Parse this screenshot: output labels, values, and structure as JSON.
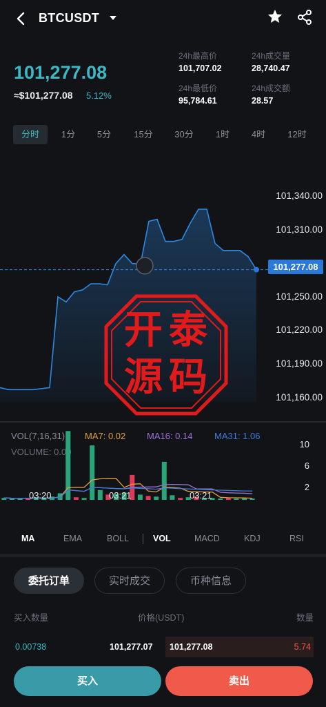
{
  "header": {
    "pair": "BTCUSDT",
    "back_icon": "chevron-left-icon",
    "star_icon": "star-icon",
    "share_icon": "share-icon"
  },
  "ticker": {
    "last_price": "101,277.08",
    "usd_price": "≈$101,277.08",
    "change_pct": "5.12%",
    "high_label": "24h最高价",
    "high_value": "101,707.02",
    "vol_label": "24h成交量",
    "vol_value": "28,740.47",
    "low_label": "24h最低价",
    "low_value": "95,784.61",
    "turnover_label": "24h成交额",
    "turnover_value": "28.57"
  },
  "timeframes": [
    "分时",
    "1分",
    "5分",
    "15分",
    "30分",
    "1时",
    "4时",
    "12时"
  ],
  "chart_data": {
    "type": "area",
    "y_ticks": [
      "101,340.00",
      "101,310.00",
      "101,250.00",
      "101,220.00",
      "101,190.00",
      "101,160.00"
    ],
    "current_price_badge": "101,277.08",
    "x_ticks": [
      "03:20",
      "03:21",
      "03:21"
    ],
    "ylim": [
      101150,
      101350
    ],
    "series": [
      {
        "values": [
          101160,
          101158,
          101158,
          101158,
          101158,
          101159,
          101160,
          101250,
          101245,
          101255,
          101257,
          101263,
          101263,
          101262,
          101283,
          101292,
          101283,
          101283,
          101325,
          101327,
          101305,
          101305,
          101307,
          101323,
          101337,
          101337,
          101303,
          101296,
          101296,
          101296,
          101290,
          101277
        ]
      }
    ],
    "grid": false,
    "legend": "none"
  },
  "indicator": {
    "vol_label": "VOL(7,16,31)",
    "ma7_label": "MA7: 0.02",
    "ma16_label": "MA16: 0.14",
    "ma31_label": "MA31: 1.06",
    "volume_label": "VOLUME: 0.00",
    "y_ticks": [
      "10",
      "6",
      "2"
    ],
    "ma7_color": "#e0a040",
    "ma16_color": "#a071d6",
    "ma31_color": "#3d7bd9",
    "bars": [
      {
        "v": 0.3,
        "c": "up"
      },
      {
        "v": 0.2,
        "c": "up"
      },
      {
        "v": 0.2,
        "c": "up"
      },
      {
        "v": 0.3,
        "c": "down"
      },
      {
        "v": 0.4,
        "c": "up"
      },
      {
        "v": 0.3,
        "c": "up"
      },
      {
        "v": 0.5,
        "c": "up"
      },
      {
        "v": 1.0,
        "c": "up"
      },
      {
        "v": 10.5,
        "c": "up"
      },
      {
        "v": 0.4,
        "c": "down"
      },
      {
        "v": 0.3,
        "c": "up"
      },
      {
        "v": 8.3,
        "c": "up"
      },
      {
        "v": 1.5,
        "c": "up"
      },
      {
        "v": 0.8,
        "c": "down"
      },
      {
        "v": 0.9,
        "c": "up"
      },
      {
        "v": 1.1,
        "c": "up"
      },
      {
        "v": 3.8,
        "c": "down"
      },
      {
        "v": 0.8,
        "c": "up"
      },
      {
        "v": 0.6,
        "c": "down"
      },
      {
        "v": 0.5,
        "c": "up"
      },
      {
        "v": 5.8,
        "c": "up"
      },
      {
        "v": 0.7,
        "c": "up"
      },
      {
        "v": 0.3,
        "c": "down"
      },
      {
        "v": 0.4,
        "c": "up"
      },
      {
        "v": 0.5,
        "c": "down"
      },
      {
        "v": 0.3,
        "c": "up"
      },
      {
        "v": 0.3,
        "c": "up"
      },
      {
        "v": 0.2,
        "c": "up"
      },
      {
        "v": 0.3,
        "c": "down"
      },
      {
        "v": 0.2,
        "c": "up"
      },
      {
        "v": 0.3,
        "c": "up"
      },
      {
        "v": 0.2,
        "c": "up"
      }
    ],
    "up_color": "#2aa57a",
    "down_color": "#e03a5a"
  },
  "indicator_tabs": [
    "MA",
    "EMA",
    "BOLL",
    "VOL",
    "MACD",
    "KDJ",
    "RSI"
  ],
  "order_tabs": [
    "委托订单",
    "实时成交",
    "币种信息"
  ],
  "order_book": {
    "col_buy_qty": "买入数量",
    "col_price": "价格(USDT)",
    "col_qty": "数量",
    "buy_qty": "0.00738",
    "buy_price": "101,277.07",
    "sell_price": "101,277.08",
    "sell_qty": "5.74"
  },
  "actions": {
    "buy": "买入",
    "sell": "卖出"
  },
  "watermark": {
    "chars": [
      "开",
      "泰",
      "源",
      "码"
    ]
  },
  "colors": {
    "accent": "#3bb8c3",
    "buy": "#3a9ba8",
    "sell": "#ef5a4b",
    "current_line": "#2a78d8"
  }
}
